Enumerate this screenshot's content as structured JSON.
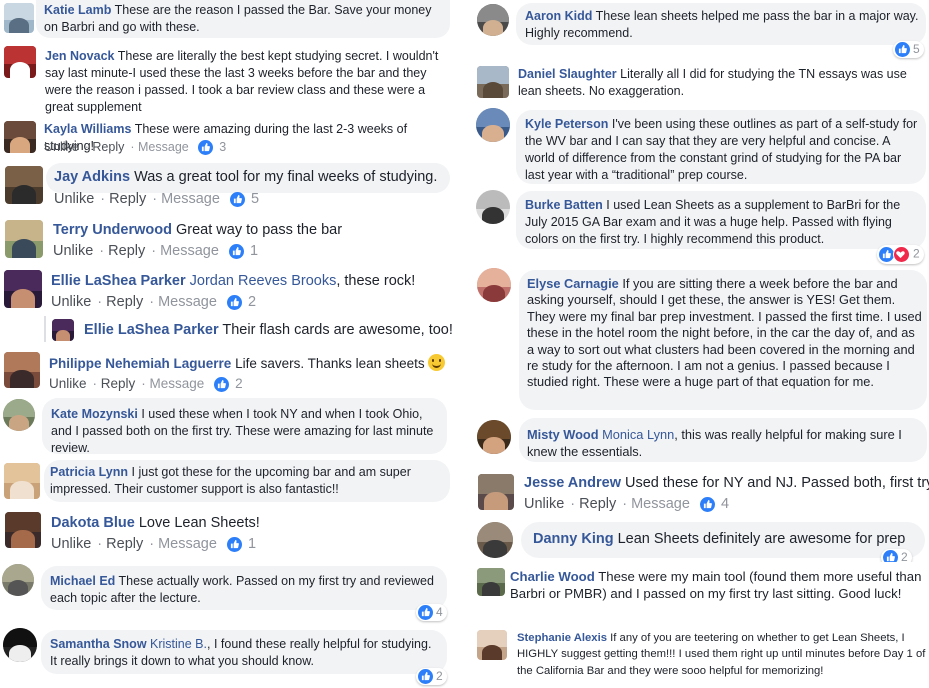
{
  "actions": {
    "unlike": "Unlike",
    "reply": "Reply",
    "message": "Message",
    "sep": " · "
  },
  "left": [
    {
      "name": "Katie Lamb",
      "text": "These are the reason I passed the Bar. Save your money on Barbri and go with these."
    },
    {
      "name": "Jen Novack",
      "text": "These are literally the best kept studying secret. I wouldn't say last minute-I used these the last 3 weeks before the bar and they were the reason i passed. I took a bar review class and these were a great supplement"
    },
    {
      "name": "Kayla Williams",
      "text": "These were amazing during the last 2-3 weeks of studying!",
      "likes": "3"
    },
    {
      "name": "Jay Adkins",
      "text": "Was a great tool for my final weeks of studying.",
      "likes": "5"
    },
    {
      "name": "Terry Underwood",
      "text": "Great way to pass the bar",
      "likes": "1"
    },
    {
      "name": "Ellie LaShea Parker",
      "tag": "Jordan Reeves Brooks",
      "text": ", these rock!",
      "likes": "2"
    },
    {
      "name": "Ellie LaShea Parker",
      "text": "Their flash cards are awesome, too!"
    },
    {
      "name": "Philippe Nehemiah Laguerre",
      "text": "Life savers. Thanks lean sheets",
      "likes": "2"
    },
    {
      "name": "Kate Mozynski",
      "text": "I used these when I took NY and when I took Ohio, and I passed both on the first try. These were amazing for last minute review."
    },
    {
      "name": "Patricia Lynn",
      "text": "I just got these for the upcoming bar and am super impressed. Their customer support is also fantastic!!"
    },
    {
      "name": "Dakota Blue",
      "text": "Love Lean Sheets!",
      "likes": "1"
    },
    {
      "name": "Michael Ed",
      "text": "These actually work. Passed on my first try and reviewed each topic after the lecture.",
      "likes": "4"
    },
    {
      "name": "Samantha Snow",
      "tag": "Kristine B.",
      "text": ", I found these really helpful for studying. It really brings it down to what you should know.",
      "likes": "2"
    }
  ],
  "right": [
    {
      "name": "Aaron Kidd",
      "text": "These lean sheets helped me pass the bar in a major way. Highly recommend.",
      "likes": "5"
    },
    {
      "name": "Daniel Slaughter",
      "text": "Literally all I did for studying the TN essays was use lean sheets. No exaggeration."
    },
    {
      "name": "Kyle Peterson",
      "text": "I've been using these outlines as part of a self-study for the WV bar and I can say that they are very helpful and concise. A world of difference from the constant grind of studying for the PA bar last year with a “traditional” prep course."
    },
    {
      "name": "Burke Batten",
      "text": "I used Lean Sheets as a supplement to BarBri for the July 2015 GA Bar exam and it was a huge help. Passed with flying colors on the first try. I highly recommend this product.",
      "likes": "2"
    },
    {
      "name": "Elyse Carnagie",
      "text": "If you are sitting there a week before the bar and asking yourself, should I get these, the answer is YES! Get them. They were my final bar prep investment. I passed the first time. I used these in the hotel room the night before, in the car the day of, and as a way to sort out what clusters had been covered in the morning and re study for the afternoon. I am not a genius. I passed because I studied right. These were a huge part of that equation for me."
    },
    {
      "name": "Misty Wood",
      "tag": "Monica Lynn",
      "text": ", this was really helpful for making sure I knew the essentials."
    },
    {
      "name": "Jesse Andrew",
      "text": "Used these for NY and NJ. Passed both, first try.",
      "likes": "4"
    },
    {
      "name": "Danny King",
      "text": "Lean Sheets definitely are awesome for prep",
      "likes": "2"
    },
    {
      "name": "Charlie Wood",
      "text": "These were my main tool (found them more useful than Barbri or PMBR) and I passed on my first try last sitting. Good luck!"
    },
    {
      "name": "Stephanie Alexis",
      "text": "If any of you are teetering on whether to get Lean Sheets, I HIGHLY suggest getting them!!! I used them right up until minutes before Day 1 of the California Bar and they were sooo helpful for memorizing!"
    }
  ]
}
